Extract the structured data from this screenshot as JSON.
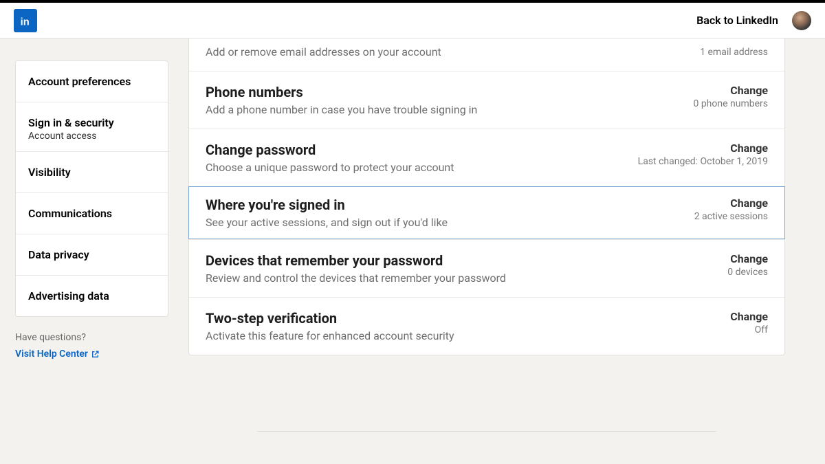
{
  "header": {
    "back_label": "Back to LinkedIn"
  },
  "sidebar": {
    "items": [
      {
        "label": "Account preferences"
      },
      {
        "label": "Sign in & security",
        "sub": "Account access"
      },
      {
        "label": "Visibility"
      },
      {
        "label": "Communications"
      },
      {
        "label": "Data privacy"
      },
      {
        "label": "Advertising data"
      }
    ]
  },
  "help": {
    "question": "Have questions?",
    "link": "Visit Help Center"
  },
  "rows": [
    {
      "title": "",
      "desc": "Add or remove email addresses on your account",
      "action": "",
      "status": "1 email address"
    },
    {
      "title": "Phone numbers",
      "desc": "Add a phone number in case you have trouble signing in",
      "action": "Change",
      "status": "0 phone numbers"
    },
    {
      "title": "Change password",
      "desc": "Choose a unique password to protect your account",
      "action": "Change",
      "status": "Last changed: October 1, 2019"
    },
    {
      "title": "Where you're signed in",
      "desc": "See your active sessions, and sign out if you'd like",
      "action": "Change",
      "status": "2 active sessions"
    },
    {
      "title": "Devices that remember your password",
      "desc": "Review and control the devices that remember your password",
      "action": "Change",
      "status": "0 devices"
    },
    {
      "title": "Two-step verification",
      "desc": "Activate this feature for enhanced account security",
      "action": "Change",
      "status": "Off"
    }
  ]
}
